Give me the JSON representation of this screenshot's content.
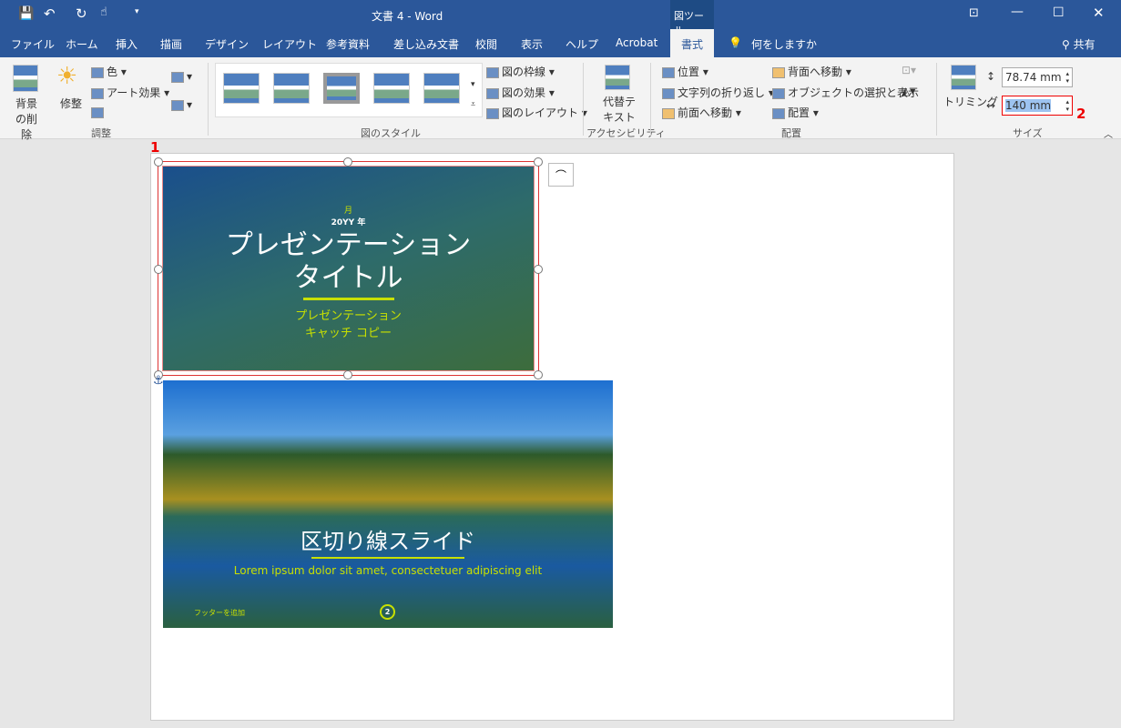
{
  "titlebar": {
    "title": "文書 4  -  Word",
    "context_tab": "図ツール"
  },
  "tabs": [
    "ファイル",
    "ホーム",
    "挿入",
    "描画",
    "デザイン",
    "レイアウト",
    "参考資料",
    "差し込み文書",
    "校閲",
    "表示",
    "ヘルプ",
    "Acrobat",
    "書式"
  ],
  "tell_me": "何をしますか",
  "share": "共有",
  "ribbon": {
    "remove_bg": "背景の削除",
    "corrections": "修整",
    "color": "色",
    "art_effects": "アート効果",
    "group_adjust": "調整",
    "border": "図の枠線",
    "effects": "図の効果",
    "layout": "図のレイアウト",
    "group_styles": "図のスタイル",
    "alt_text": "代替テキスト",
    "group_access": "アクセシビリティ",
    "position": "位置",
    "wrap": "文字列の折り返し",
    "bring_forward": "前面へ移動",
    "send_backward": "背面へ移動",
    "selection_pane": "オブジェクトの選択と表示",
    "align": "配置",
    "group_arrange": "配置",
    "crop": "トリミング",
    "height": "78.74 mm",
    "width": "140 mm",
    "group_size": "サイズ"
  },
  "slide1": {
    "month": "月",
    "year": "20YY 年",
    "title1": "プレゼンテーション",
    "title2": "タイトル",
    "sub1": "プレゼンテーション",
    "sub2": "キャッチ コピー"
  },
  "slide2": {
    "title": "区切り線スライド",
    "subtitle": "Lorem ipsum dolor sit amet, consectetuer adipiscing elit",
    "footer": "フッターを追加",
    "page_num": "2"
  },
  "annotations": [
    "1",
    "2"
  ],
  "colors": {
    "brand": "#2b579a",
    "accent_yellow": "#c8e000",
    "annotation": "#e00000"
  }
}
